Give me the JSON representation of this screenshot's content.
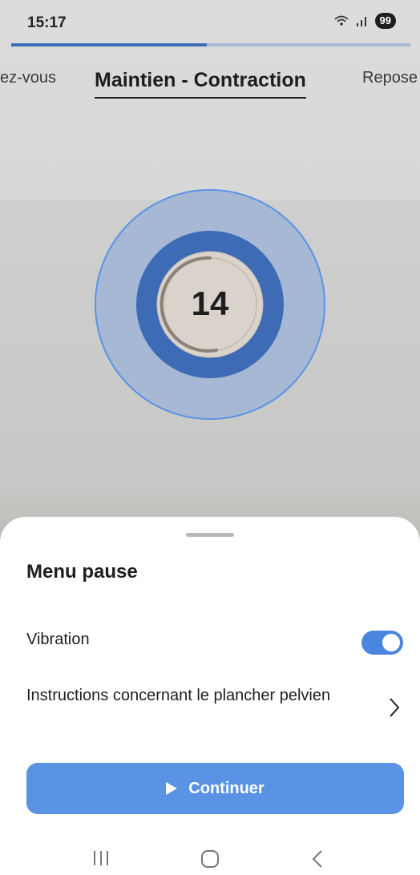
{
  "status": {
    "time": "15:17",
    "battery": "99"
  },
  "exercise": {
    "progress_fraction": 0.49,
    "tabs": {
      "left": "ez-vous",
      "active": "Maintien - Contraction",
      "right": "Repose"
    },
    "counter": "14"
  },
  "pause_menu": {
    "title": "Menu pause",
    "vibration_label": "Vibration",
    "vibration_on": true,
    "instructions_label": "Instructions concernant le plancher pelvien",
    "continue_label": "Continuer"
  },
  "nav": {
    "recents_icon": "recents-icon",
    "home_icon": "home-icon",
    "back_icon": "back-icon"
  },
  "colors": {
    "accent": "#5a93e4",
    "ring": "#3d6bb5",
    "toggle": "#4a86e0"
  }
}
